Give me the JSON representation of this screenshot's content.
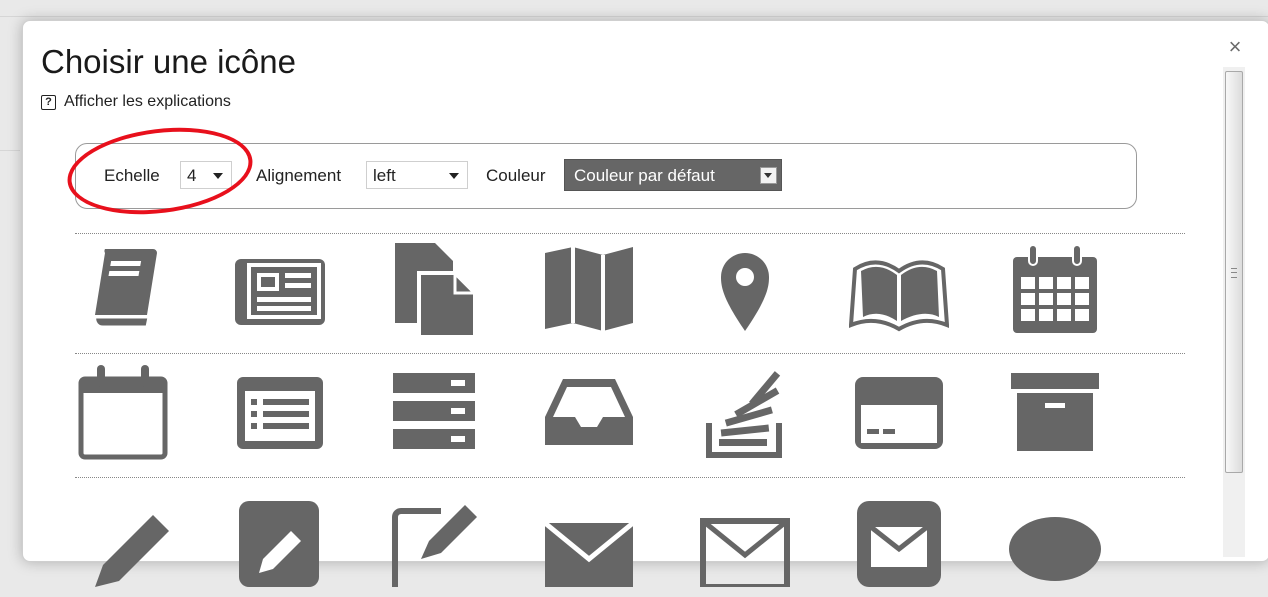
{
  "dialog": {
    "title": "Choisir une icône",
    "close_glyph": "×",
    "help_icon_glyph": "?",
    "help_link": "Afficher les explications"
  },
  "options": {
    "scale_label": "Echelle",
    "scale_value": "4",
    "alignment_label": "Alignement",
    "alignment_value": "left",
    "color_label": "Couleur",
    "color_value": "Couleur par défaut",
    "color_swatch": "#666666"
  },
  "annotation": {
    "ring_color": "#e8101c"
  },
  "icon_color": "#666666",
  "icon_rows": [
    [
      "book-icon",
      "newspaper-icon",
      "documents-icon",
      "map-icon",
      "map-marker-icon",
      "open-book-icon",
      "calendar-icon"
    ],
    [
      "empty-calendar-icon",
      "list-window-icon",
      "server-icon",
      "inbox-icon",
      "stack-overflow-icon",
      "credit-card-icon",
      "archive-box-icon"
    ],
    [
      "pencil-icon",
      "edit-square-icon",
      "compose-icon",
      "envelope-icon",
      "envelope-outline-icon",
      "mail-square-icon",
      "speech-bubble-icon"
    ]
  ]
}
